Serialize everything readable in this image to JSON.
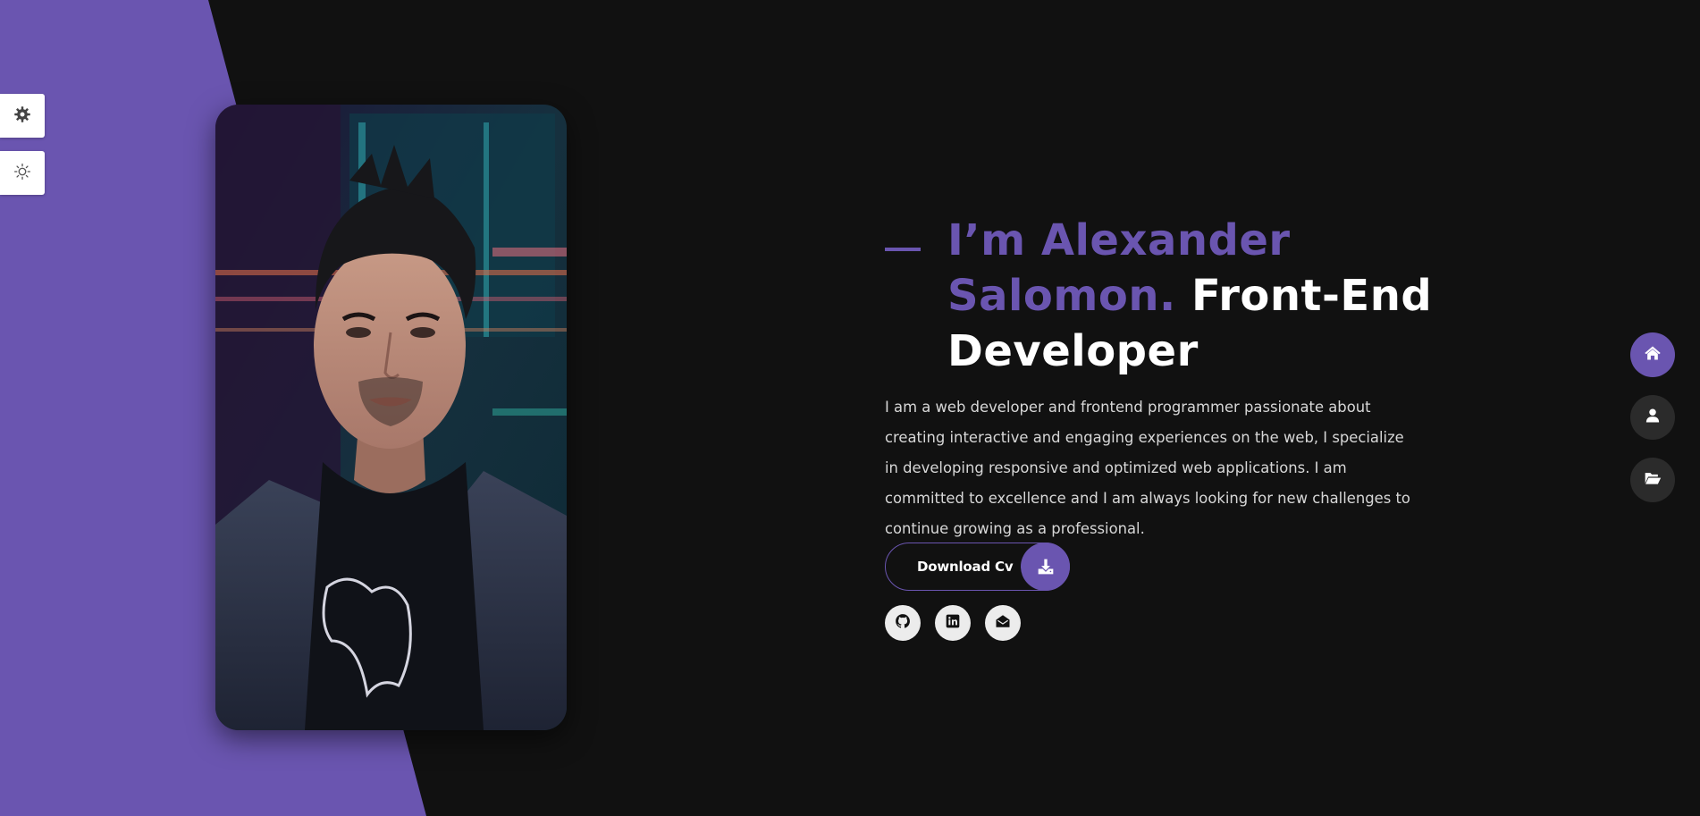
{
  "colors": {
    "accent": "#6a55b0",
    "background": "#111111",
    "text": "#ffffff",
    "muted_text": "#d7d7d7"
  },
  "side_tools": [
    {
      "icon": "gear-icon"
    },
    {
      "icon": "sun-icon"
    }
  ],
  "profile_photo": {
    "description_icon": "profile-photo"
  },
  "hero": {
    "title_accent": "I’m Alexander Salomon.",
    "title_rest": "Front-End Developer",
    "description": "I am a web developer and frontend programmer passionate about creating interactive and engaging experiences on the web, I specialize in developing responsive and optimized web applications. I am committed to excellence and I am always looking for new challenges to continue growing as a professional.",
    "download_label": "Download Cv",
    "download_icon": "download-icon"
  },
  "socials": [
    {
      "icon": "github-icon"
    },
    {
      "icon": "linkedin-icon"
    },
    {
      "icon": "envelope-open-icon"
    }
  ],
  "nav": [
    {
      "icon": "home-icon",
      "active": true
    },
    {
      "icon": "user-icon",
      "active": false
    },
    {
      "icon": "folder-open-icon",
      "active": false
    }
  ]
}
